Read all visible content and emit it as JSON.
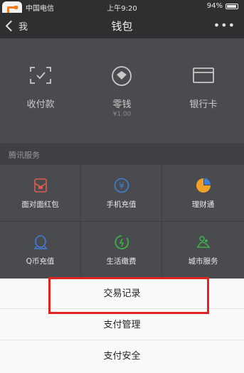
{
  "status_bar": {
    "carrier": "中国电信",
    "time": "上午9:20",
    "battery": "94%"
  },
  "nav": {
    "back_label": "我",
    "title": "钱包",
    "more": "•••"
  },
  "wallet_functions": [
    {
      "label": "收付款",
      "icon": "scan-pay-icon"
    },
    {
      "label": "零钱",
      "sub": "¥1.00",
      "icon": "change-coin-icon"
    },
    {
      "label": "银行卡",
      "icon": "bank-card-icon"
    }
  ],
  "tencent_services": {
    "header": "腾讯服务",
    "items": [
      {
        "label": "面对面红包",
        "icon": "red-packet-icon"
      },
      {
        "label": "手机充值",
        "icon": "phone-recharge-icon"
      },
      {
        "label": "理财通",
        "icon": "wealth-icon"
      },
      {
        "label": "Q币充值",
        "icon": "qcoin-icon"
      },
      {
        "label": "生活缴费",
        "icon": "utility-payment-icon"
      },
      {
        "label": "城市服务",
        "icon": "city-services-icon"
      }
    ]
  },
  "action_sheet": {
    "options": [
      "交易记录",
      "支付管理",
      "支付安全"
    ]
  },
  "colors": {
    "highlight_border": "#e02424",
    "red_packet": "#e05a52",
    "phone_recharge": "#3f7fd6",
    "wealth": "#f0a12a",
    "qcoin": "#3f7fd6",
    "utility": "#3fae4a",
    "city": "#3fae4a"
  }
}
